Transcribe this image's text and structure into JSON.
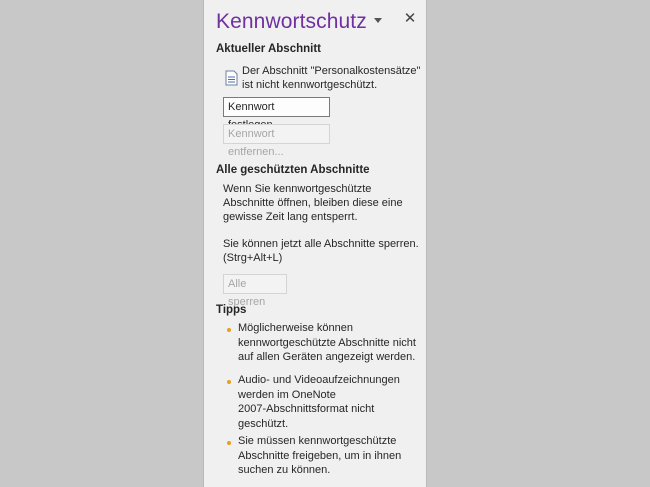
{
  "pane": {
    "title": "Kennwortschutz",
    "current_section": {
      "heading": "Aktueller Abschnitt",
      "status_line1": "Der Abschnitt \"Personalkostensätze\"",
      "status_line2": "ist nicht kennwortgeschützt.",
      "set_password_label": "Kennwort festlegen...",
      "remove_password_label": "Kennwort entfernen..."
    },
    "all_sections": {
      "heading": "Alle geschützten Abschnitte",
      "info_lines": [
        "Wenn Sie kennwortgeschützte",
        "Abschnitte öffnen, bleiben diese eine",
        "gewisse Zeit lang entsperrt."
      ],
      "lock_lines": [
        "Sie können jetzt alle Abschnitte sperren.",
        "(Strg+Alt+L)"
      ],
      "lock_all_label": "Alle sperren"
    },
    "tips": {
      "heading": "Tipps",
      "items": [
        [
          "Möglicherweise können",
          "kennwortgeschützte Abschnitte nicht",
          "auf allen Geräten angezeigt werden."
        ],
        [
          "Audio- und Videoaufzeichnungen",
          "werden im OneNote",
          "2007-Abschnittsformat nicht",
          "geschützt."
        ],
        [
          "Sie müssen kennwortgeschützte",
          "Abschnitte freigeben, um in ihnen",
          "suchen zu können."
        ]
      ]
    }
  },
  "colors": {
    "title": "#7030a0",
    "bullet": "#e6a11a",
    "background": "#c8c8c8",
    "pane": "#f0f0f0"
  },
  "icons": {
    "dropdown": "chevron-down-icon",
    "close": "close-icon",
    "section": "document-icon"
  }
}
